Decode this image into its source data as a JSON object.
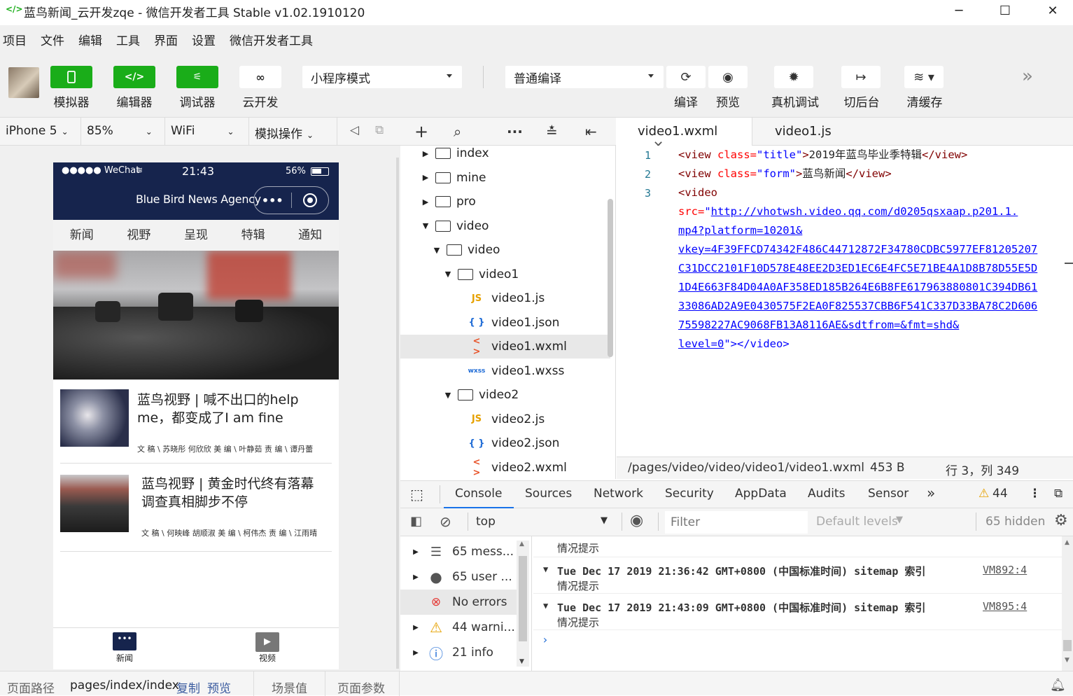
{
  "window": {
    "title": "蓝鸟新闻_云开发zqe - 微信开发者工具 Stable v1.02.1910120",
    "logo": "</>",
    "minimize": "─",
    "maximize": "☐",
    "close": "✕"
  },
  "menu": [
    "项目",
    "文件",
    "编辑",
    "工具",
    "界面",
    "设置",
    "微信开发者工具"
  ],
  "toolbar": {
    "simulator": "模拟器",
    "editor": "编辑器",
    "debugger": "调试器",
    "cloud": "云开发",
    "mode": "小程序模式",
    "compile_mode": "普通编译",
    "compile": "编译",
    "preview": "预览",
    "remote_debug": "真机调试",
    "background": "切后台",
    "clear_cache": "清缓存",
    "more": "»"
  },
  "simbar": {
    "device": "iPhone 5",
    "zoom": "85%",
    "network": "WiFi",
    "ops": "模拟操作"
  },
  "phone": {
    "carrier": "●●●●● WeChat",
    "time": "21:43",
    "battery": "56%",
    "nav_title": "Blue Bird News Agency",
    "tabs": [
      "新闻",
      "视野",
      "呈现",
      "特辑",
      "通知"
    ],
    "news": [
      {
        "title": "蓝鸟视野 | 喊不出口的help me，都变成了I am fine",
        "meta": "文 稿 \\ 苏晓彤 何欣欣 美 编 \\ 叶静茹 责 编 \\ 谭丹蕾"
      },
      {
        "title": "蓝鸟视野 | 黄金时代终有落幕 调查真相脚步不停",
        "meta": "文 稿 \\ 何映峰 胡顺淑 美 编 \\ 柯伟杰 责 编 \\ 江雨晴"
      }
    ],
    "tabbar": [
      "新闻",
      "视频"
    ]
  },
  "tree": [
    {
      "name": "index",
      "kind": "folder",
      "depth": 0,
      "open": false
    },
    {
      "name": "mine",
      "kind": "folder",
      "depth": 0,
      "open": false
    },
    {
      "name": "pro",
      "kind": "folder",
      "depth": 0,
      "open": false
    },
    {
      "name": "video",
      "kind": "folder",
      "depth": 0,
      "open": true
    },
    {
      "name": "video",
      "kind": "folder",
      "depth": 1,
      "open": true
    },
    {
      "name": "video1",
      "kind": "folder",
      "depth": 2,
      "open": true
    },
    {
      "name": "video1.js",
      "kind": "js",
      "depth": 3
    },
    {
      "name": "video1.json",
      "kind": "json",
      "depth": 3
    },
    {
      "name": "video1.wxml",
      "kind": "wxml",
      "depth": 3,
      "selected": true
    },
    {
      "name": "video1.wxss",
      "kind": "wxss",
      "depth": 3
    },
    {
      "name": "video2",
      "kind": "folder",
      "depth": 2,
      "open": true
    },
    {
      "name": "video2.js",
      "kind": "js",
      "depth": 3
    },
    {
      "name": "video2.json",
      "kind": "json",
      "depth": 3
    },
    {
      "name": "video2.wxml",
      "kind": "wxml",
      "depth": 3
    }
  ],
  "file_icons": {
    "js": "JS",
    "json": "{ }",
    "wxml": "< >",
    "wxss": "wxss"
  },
  "editor": {
    "tabs": [
      "video1.wxml",
      "video1.js"
    ],
    "line_numbers": [
      "1",
      "2",
      "3"
    ],
    "line1": {
      "open": "<view ",
      "attr": "class=",
      "val": "\"title\"",
      "close": ">",
      "text": "2019年蓝鸟毕业季特辑",
      "end": "</view>"
    },
    "line2": {
      "open": "<view ",
      "attr": "class=",
      "val": "\"form\"",
      "close": ">",
      "text": "蓝鸟新闻",
      "end": "</view>"
    },
    "line3_open": "<video",
    "src_attr": "src=",
    "src_lines": [
      "http://vhotwsh.video.qq.com/d0205qsxaap.p201.1.",
      "mp4?platform=10201&",
      "vkey=4F39FFCD74342F486C44712872F34780CDBC5977EF81205207",
      "C31DCC2101F10D578E48EE2D3ED1EC6E4FC5E71BE4A1D8B78D55E5D",
      "1D4E663F84D04A0AF358ED185B264E6B8FE617963880801C394DB61",
      "33086AD2A9E0430575F2EA0F825537CBB6F541C337D33BA78C2D606",
      "75598227AC9068FB13A8116AE&sdtfrom=&fmt=shd&",
      "level=0"
    ],
    "src_tail": "\"></video>",
    "path": "/pages/video/video/video1/video1.wxml",
    "size": "453 B",
    "cursor": "行 3，列 349"
  },
  "devtools": {
    "tabs": [
      "Console",
      "Sources",
      "Network",
      "Security",
      "AppData",
      "Audits",
      "Sensor"
    ],
    "warn_count": "44",
    "context": "top",
    "filter_placeholder": "Filter",
    "levels": "Default levels",
    "hidden": "65 hidden",
    "side": [
      {
        "label": "65 mess...",
        "icon": "list"
      },
      {
        "label": "65 user ...",
        "icon": "user"
      },
      {
        "label": "No errors",
        "icon": "error",
        "selected": true
      },
      {
        "label": "44 warni...",
        "icon": "warn"
      },
      {
        "label": "21 info",
        "icon": "info"
      }
    ],
    "logs": [
      {
        "text": "Tue Dec 17 2019 21:36:42 GMT+0800 (中国标准时间) sitemap 索引",
        "sub": "情况提示",
        "link": "VM892:4"
      },
      {
        "text": "Tue Dec 17 2019 21:43:09 GMT+0800 (中国标准时间) sitemap 索引",
        "sub": "情况提示",
        "link": "VM895:4"
      }
    ],
    "top_partial": "情况提示"
  },
  "bottombar": {
    "path_label": "页面路径",
    "path": "pages/index/index",
    "copy": "复制",
    "preview": "预览",
    "scene": "场景值",
    "params": "页面参数"
  }
}
